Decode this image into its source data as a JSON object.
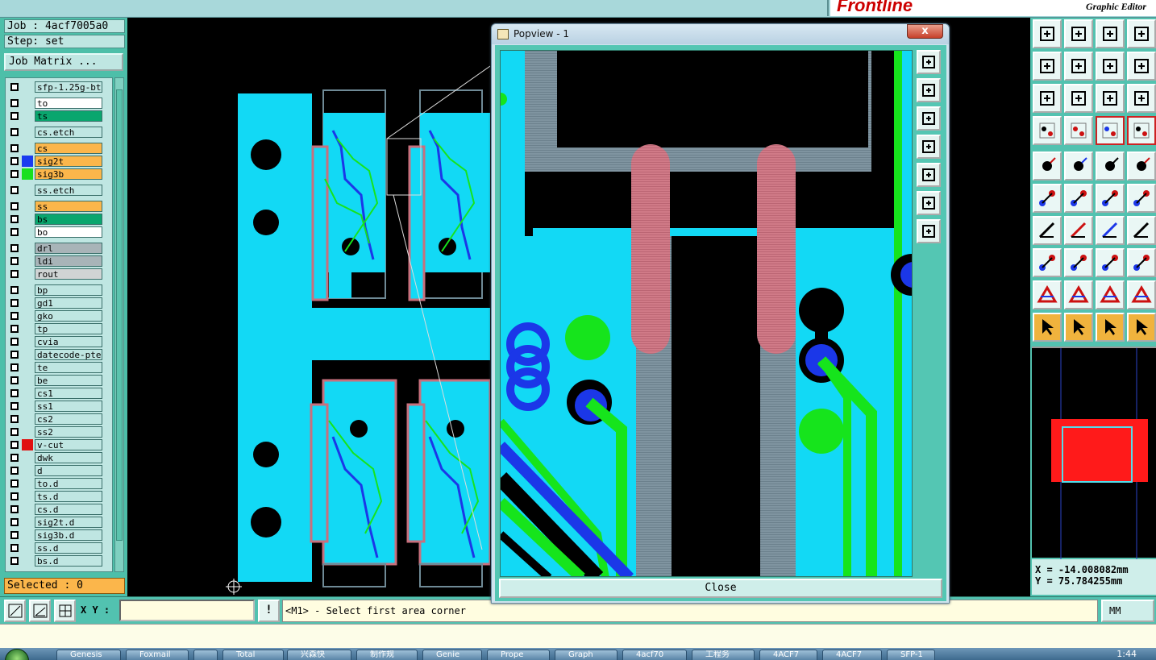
{
  "app": {
    "brand_logo": "Frontline",
    "brand_subtitle": "Graphic Editor"
  },
  "job": {
    "job_label": "Job : 4acf7005a0",
    "step_label": "Step: set",
    "job_matrix_button": "Job Matrix ..."
  },
  "layers": [
    {
      "name": "sfp-1.25g-bt",
      "color": "#bfe6e2",
      "swatch": ""
    },
    {
      "name": "to",
      "color": "#ffffff",
      "swatch": ""
    },
    {
      "name": "ts",
      "color": "#0aa66e",
      "swatch": ""
    },
    {
      "name": "cs.etch",
      "color": "#bfe6e2",
      "swatch": ""
    },
    {
      "name": "cs",
      "color": "#fbb64b",
      "swatch": ""
    },
    {
      "name": "sig2t",
      "color": "#fbb64b",
      "swatch": "#1a3cf0"
    },
    {
      "name": "sig3b",
      "color": "#fbb64b",
      "swatch": "#18e01e"
    },
    {
      "name": "ss.etch",
      "color": "#bfe6e2",
      "swatch": ""
    },
    {
      "name": "ss",
      "color": "#fbb64b",
      "swatch": ""
    },
    {
      "name": "bs",
      "color": "#0aa66e",
      "swatch": ""
    },
    {
      "name": "bo",
      "color": "#ffffff",
      "swatch": ""
    },
    {
      "name": "drl",
      "color": "#a8b4b8",
      "swatch": ""
    },
    {
      "name": "ldi",
      "color": "#a8b4b8",
      "swatch": ""
    },
    {
      "name": "rout",
      "color": "#d0d4d4",
      "swatch": ""
    },
    {
      "name": "bp",
      "color": "#bfe6e2",
      "swatch": ""
    },
    {
      "name": "gd1",
      "color": "#bfe6e2",
      "swatch": ""
    },
    {
      "name": "gko",
      "color": "#bfe6e2",
      "swatch": ""
    },
    {
      "name": "tp",
      "color": "#bfe6e2",
      "swatch": ""
    },
    {
      "name": "cvia",
      "color": "#bfe6e2",
      "swatch": ""
    },
    {
      "name": "datecode-pte",
      "color": "#bfe6e2",
      "swatch": ""
    },
    {
      "name": "te",
      "color": "#bfe6e2",
      "swatch": ""
    },
    {
      "name": "be",
      "color": "#bfe6e2",
      "swatch": ""
    },
    {
      "name": "cs1",
      "color": "#bfe6e2",
      "swatch": ""
    },
    {
      "name": "ss1",
      "color": "#bfe6e2",
      "swatch": ""
    },
    {
      "name": "cs2",
      "color": "#bfe6e2",
      "swatch": ""
    },
    {
      "name": "ss2",
      "color": "#bfe6e2",
      "swatch": ""
    },
    {
      "name": "v-cut",
      "color": "#bfe6e2",
      "swatch": "#e01010"
    },
    {
      "name": "dwk",
      "color": "#bfe6e2",
      "swatch": ""
    },
    {
      "name": "d",
      "color": "#bfe6e2",
      "swatch": ""
    },
    {
      "name": "to.d",
      "color": "#bfe6e2",
      "swatch": ""
    },
    {
      "name": "ts.d",
      "color": "#bfe6e2",
      "swatch": ""
    },
    {
      "name": "cs.d",
      "color": "#bfe6e2",
      "swatch": ""
    },
    {
      "name": "sig2t.d",
      "color": "#bfe6e2",
      "swatch": ""
    },
    {
      "name": "sig3b.d",
      "color": "#bfe6e2",
      "swatch": ""
    },
    {
      "name": "ss.d",
      "color": "#bfe6e2",
      "swatch": ""
    },
    {
      "name": "bs.d",
      "color": "#bfe6e2",
      "swatch": ""
    }
  ],
  "selected_label": "Selected : 0",
  "popview": {
    "title": "Popview - 1",
    "close_button": "Close",
    "close_x": "x"
  },
  "coords": {
    "x": "X = -14.008082mm",
    "y": "Y = 75.784255mm"
  },
  "command": {
    "xy_label": "X Y :",
    "xy_value": "",
    "exclaim": "!",
    "prompt": "<M1> - Select first area corner",
    "units": "MM"
  },
  "taskbar": {
    "tasks": [
      "Genesis",
      "Foxmail",
      "",
      "Total",
      "兴森快",
      "制作规",
      "Genie",
      "Prope",
      "Graph",
      "4acf70",
      "工程务",
      "4ACF7",
      "4ACF7",
      "SFP-1"
    ],
    "clock": "1:44"
  },
  "colors": {
    "cyan": "#12d9f5",
    "green": "#16e41c",
    "blue": "#1b37e8",
    "pink": "#c8707d",
    "grey": "#6f8a96",
    "panel": "#53c2b0"
  }
}
